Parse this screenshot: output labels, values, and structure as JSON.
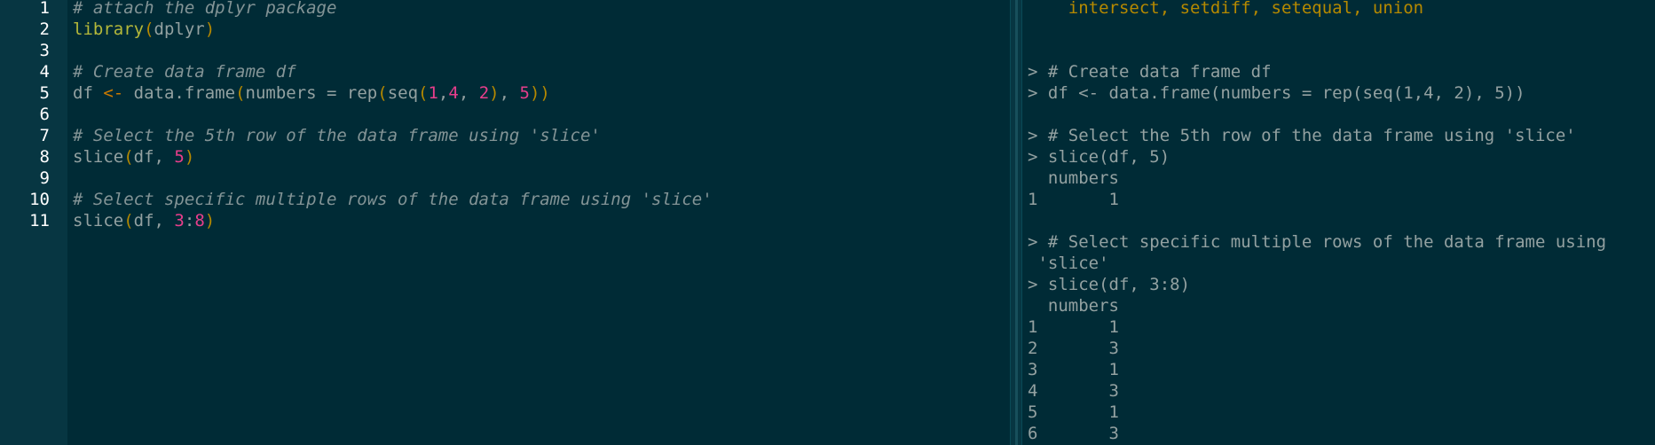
{
  "editor": {
    "lines": [
      {
        "no": "1",
        "segments": [
          {
            "t": "# attach the dplyr package",
            "c": "comment"
          }
        ]
      },
      {
        "no": "2",
        "segments": [
          {
            "t": "library",
            "c": "func"
          },
          {
            "t": "(",
            "c": "paren"
          },
          {
            "t": "dplyr",
            "c": "plain"
          },
          {
            "t": ")",
            "c": "paren"
          }
        ]
      },
      {
        "no": "3",
        "segments": []
      },
      {
        "no": "4",
        "segments": [
          {
            "t": "# Create data frame df",
            "c": "comment"
          }
        ]
      },
      {
        "no": "5",
        "segments": [
          {
            "t": "df ",
            "c": "plain"
          },
          {
            "t": "<-",
            "c": "op"
          },
          {
            "t": " data.frame",
            "c": "plain"
          },
          {
            "t": "(",
            "c": "paren"
          },
          {
            "t": "numbers = rep",
            "c": "plain"
          },
          {
            "t": "(",
            "c": "paren"
          },
          {
            "t": "seq",
            "c": "plain"
          },
          {
            "t": "(",
            "c": "paren"
          },
          {
            "t": "1",
            "c": "num"
          },
          {
            "t": ",",
            "c": "plain"
          },
          {
            "t": "4",
            "c": "num"
          },
          {
            "t": ", ",
            "c": "plain"
          },
          {
            "t": "2",
            "c": "num"
          },
          {
            "t": ")",
            "c": "paren"
          },
          {
            "t": ", ",
            "c": "plain"
          },
          {
            "t": "5",
            "c": "num"
          },
          {
            "t": "))",
            "c": "paren"
          }
        ]
      },
      {
        "no": "6",
        "segments": []
      },
      {
        "no": "7",
        "segments": [
          {
            "t": "# Select the 5th row of the data frame using 'slice'",
            "c": "comment"
          }
        ]
      },
      {
        "no": "8",
        "segments": [
          {
            "t": "slice",
            "c": "plain"
          },
          {
            "t": "(",
            "c": "paren"
          },
          {
            "t": "df, ",
            "c": "plain"
          },
          {
            "t": "5",
            "c": "num"
          },
          {
            "t": ")",
            "c": "paren"
          }
        ]
      },
      {
        "no": "9",
        "segments": []
      },
      {
        "no": "10",
        "segments": [
          {
            "t": "# Select specific multiple rows of the data frame using 'slice'",
            "c": "comment"
          }
        ]
      },
      {
        "no": "11",
        "segments": [
          {
            "t": "slice",
            "c": "plain"
          },
          {
            "t": "(",
            "c": "paren"
          },
          {
            "t": "df, ",
            "c": "plain"
          },
          {
            "t": "3",
            "c": "num"
          },
          {
            "t": ":",
            "c": "plain"
          },
          {
            "t": "8",
            "c": "num"
          },
          {
            "t": ")",
            "c": "paren"
          }
        ]
      }
    ]
  },
  "console": {
    "lines": [
      {
        "t": "    intersect, setdiff, setequal, union",
        "c": "msg"
      },
      {
        "t": "",
        "c": ""
      },
      {
        "t": "",
        "c": ""
      },
      {
        "t": "> # Create data frame df",
        "c": ""
      },
      {
        "t": "> df <- data.frame(numbers = rep(seq(1,4, 2), 5))",
        "c": ""
      },
      {
        "t": "",
        "c": ""
      },
      {
        "t": "> # Select the 5th row of the data frame using 'slice'",
        "c": ""
      },
      {
        "t": "> slice(df, 5)",
        "c": ""
      },
      {
        "t": "  numbers",
        "c": ""
      },
      {
        "t": "1       1",
        "c": ""
      },
      {
        "t": "",
        "c": ""
      },
      {
        "t": "> # Select specific multiple rows of the data frame using",
        "c": ""
      },
      {
        "t": " 'slice'",
        "c": ""
      },
      {
        "t": "> slice(df, 3:8)",
        "c": ""
      },
      {
        "t": "  numbers",
        "c": ""
      },
      {
        "t": "1       1",
        "c": ""
      },
      {
        "t": "2       3",
        "c": ""
      },
      {
        "t": "3       1",
        "c": ""
      },
      {
        "t": "4       3",
        "c": ""
      },
      {
        "t": "5       1",
        "c": ""
      },
      {
        "t": "6       3",
        "c": ""
      }
    ]
  }
}
